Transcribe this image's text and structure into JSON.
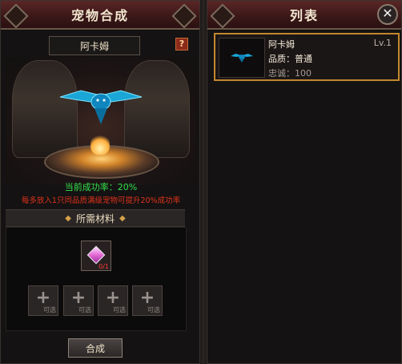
{
  "left_panel": {
    "title": "宠物合成",
    "pet_name": "阿卡姆",
    "help": "?",
    "success_rate": "当前成功率：20%",
    "bonus_hint": "每多放入1只同品质满级宠物可提升20%成功率",
    "materials_title": "所需材料",
    "material": {
      "count": "0/1",
      "icon": "pink-gem-icon"
    },
    "add_slots": [
      {
        "plus": "+",
        "label": "可选"
      },
      {
        "plus": "+",
        "label": "可选"
      },
      {
        "plus": "+",
        "label": "可选"
      },
      {
        "plus": "+",
        "label": "可选"
      }
    ],
    "compose_button": "合成"
  },
  "right_panel": {
    "title": "列表",
    "close": "✕",
    "items": [
      {
        "name": "阿卡姆",
        "level": "Lv.1",
        "quality": "品质：普通",
        "loyalty": "忠诚：100"
      }
    ]
  },
  "colors": {
    "success": "#32e04a",
    "hint": "#e0331c",
    "selected_border": "#c2872e"
  }
}
